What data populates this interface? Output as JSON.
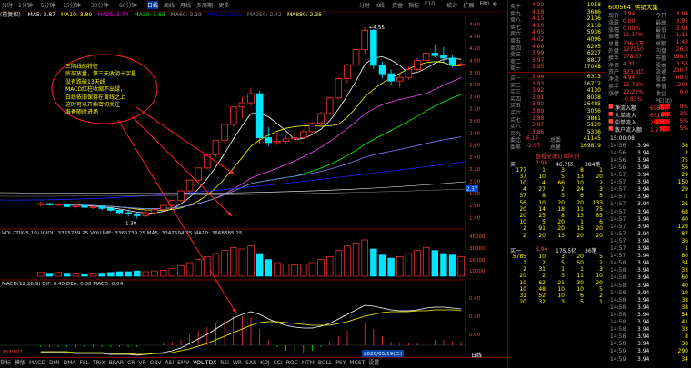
{
  "toolbar": {
    "periods": [
      "分时",
      "1分钟",
      "5分钟",
      "15分钟",
      "30分钟",
      "60分钟",
      "日线",
      "周线",
      "月线",
      "多周期",
      "更多"
    ],
    "indicators": [
      "分时",
      "K线",
      "资金",
      "指标",
      "F10",
      "统计",
      "扩展",
      "F10"
    ],
    "active": "日线"
  },
  "main_title": {
    "name": "(前复权)",
    "ma": [
      "MA5: 3.87",
      "MA10: 3.89",
      "MA20: 3.74",
      "MA30: 3.63",
      "MA60: 3.19",
      "MA120: 2.91",
      "MA250: 2.42",
      "MA880: 2.35"
    ]
  },
  "price_labels": {
    "high": "4.55",
    "low": "1.38",
    "right_ticks": [
      "4.60",
      "4.40",
      "4.20",
      "4.00",
      "3.80",
      "3.60",
      "3.40",
      "3.20",
      "3.00",
      "2.80",
      "2.60",
      "2.40",
      "2.20",
      "2.00",
      "1.80",
      "1.60",
      "1.40"
    ],
    "tag": "2.37"
  },
  "annotation": {
    "lines": [
      "三阴线的特征",
      "底部放量，第三天收阴十字星",
      "没有跌破13天线",
      "MACD红柱收缩不出绿，",
      "白线依旧保持在黄线之上",
      "这时可以开始密切关注",
      "准备随时进场"
    ]
  },
  "volume_title": "VOL-TDX(5,10)  VVOL: 3365739.25  VOLUME: 3365739.25  MA5: 3347594.25  MA10: 3668385.25",
  "volume_ticks": [
    "45000",
    "30000",
    "15000",
    "10000"
  ],
  "macd_title": "MACD(12,26,9)  DIF: 0.40  DEA: 0.38  MACD: 0.04",
  "macd_ticks": [
    "0.40",
    "0.20",
    "0.00"
  ],
  "date_labels": [
    "2020/01",
    "2020/05/19(二)"
  ],
  "bottom_tabs": [
    "指标",
    "模版",
    "MACD",
    "DMI",
    "DMA",
    "FSL",
    "TRIX",
    "BRAR",
    "CR",
    "VR",
    "OBV",
    "ASI",
    "EMV",
    "VOL-TDX",
    "RSI",
    "WR",
    "SAR",
    "KDJ",
    "CCI",
    "ROC",
    "MTM",
    "BOLL",
    "PSY",
    "MCST",
    "设置"
  ],
  "right_tab": "日线",
  "order_book": {
    "asks": [
      {
        "label": "卖十",
        "price": "4.20",
        "vol": "1958"
      },
      {
        "label": "卖九",
        "price": "4.18",
        "vol": "3686"
      },
      {
        "label": "卖八",
        "price": "4.15",
        "vol": "2136"
      },
      {
        "label": "卖七",
        "price": "4.10",
        "vol": "2118"
      },
      {
        "label": "卖六",
        "price": "4.05",
        "vol": "5936"
      },
      {
        "label": "卖五",
        "price": "4.02",
        "vol": "4096"
      },
      {
        "label": "卖四",
        "price": "4.00",
        "vol": "8295"
      },
      {
        "label": "卖三",
        "price": "3.99",
        "vol": "6227"
      },
      {
        "label": "卖二",
        "price": "3.97",
        "vol": "8817"
      },
      {
        "label": "卖一",
        "price": "3.95",
        "vol": "17048"
      }
    ],
    "bids": [
      {
        "label": "买一",
        "price": "3.94",
        "vol": "6313"
      },
      {
        "label": "买二",
        "price": "3.93",
        "vol": "16712"
      },
      {
        "label": "买三",
        "price": "3.92",
        "vol": "4130"
      },
      {
        "label": "买四",
        "price": "3.91",
        "vol": "8038"
      },
      {
        "label": "买五",
        "price": "3.90",
        "vol": "26485"
      },
      {
        "label": "买六",
        "price": "3.89",
        "vol": "3056"
      },
      {
        "label": "买七",
        "price": "3.88",
        "vol": "3861"
      },
      {
        "label": "买八",
        "price": "3.87",
        "vol": "5120"
      },
      {
        "label": "买九",
        "price": "3.86",
        "vol": "5336"
      }
    ],
    "summary": [
      {
        "l": "委比",
        "v": "6.17",
        "l2": "总委",
        "v2": "41145"
      },
      {
        "l": "委差",
        "v": "-2.07",
        "l2": "总量",
        "v2": "169819"
      }
    ]
  },
  "book2": {
    "title": "查看全速订单队列",
    "head": [
      "买一",
      "3.96",
      "46.7亿",
      "384笔"
    ],
    "rows": [
      [
        "177",
        "1",
        "3",
        "8",
        "1"
      ],
      [
        "37",
        "10",
        "5",
        "13",
        "20"
      ],
      [
        "10",
        "4",
        "66",
        "10",
        "2"
      ],
      [
        "4",
        "27",
        "2",
        "24",
        "3"
      ],
      [
        "37",
        "8",
        "3",
        "6",
        "5"
      ],
      [
        "56",
        "10",
        "20",
        "20",
        "133"
      ],
      [
        "20",
        "14",
        "18",
        "11",
        "75"
      ],
      [
        "20",
        "25",
        "8",
        "13",
        "65"
      ],
      [
        "10",
        "5",
        "20",
        "1",
        "6"
      ],
      [
        "2",
        "91",
        "20",
        "15",
        "20"
      ],
      [
        "2",
        "20",
        "13",
        "20",
        "20"
      ]
    ],
    "head2": [
      "买一",
      "3.94",
      "175.5亿",
      "36笔"
    ],
    "rows2": [
      [
        "5785",
        "10",
        "3",
        "20",
        "5"
      ],
      [
        "1",
        "2",
        "5",
        "50",
        "2"
      ],
      [
        "2",
        "31",
        "1",
        "1",
        "3"
      ],
      [
        "20",
        "2",
        "3",
        "11",
        "10"
      ],
      [
        "10",
        "62",
        "21",
        "30",
        "20"
      ],
      [
        "10",
        "48",
        "10",
        "10",
        "5"
      ],
      [
        "31",
        "52",
        "10",
        "6",
        "2"
      ],
      [
        "20",
        "32",
        "3",
        "5",
        "1"
      ]
    ]
  },
  "stock_info": {
    "code": "600564",
    "name": "供销大集",
    "fields": [
      {
        "l": "现价",
        "v": "3.94",
        "l2": "今开",
        "v2": "3.94"
      },
      {
        "l": "涨跌",
        "v": "0.00",
        "l2": "最高",
        "v2": "3.95"
      },
      {
        "l": "涨幅",
        "v": "0.00%",
        "l2": "最低",
        "v2": "3.94"
      },
      {
        "l": "振幅",
        "v": "11.17%",
        "l2": "量比",
        "v2": "1.15"
      },
      {
        "l": "总量",
        "v": "336.6万",
        "l2": "总额",
        "v2": "1.43"
      },
      {
        "l": "外盘",
        "v": "127950",
        "l2": "内盘",
        "v2": "26.3"
      },
      {
        "l": "换手",
        "v": "178.87",
        "l2": "市盈",
        "v2": "198.5"
      },
      {
        "l": "净资",
        "v": "4.31",
        "l2": "股本",
        "v2": "3.55"
      },
      {
        "l": "资产",
        "v": "523.8亿",
        "l2": "流通",
        "v2": "236.7"
      },
      {
        "l": "净流",
        "v": "4.94",
        "l2": "股本",
        "v2": "60.0"
      },
      {
        "l": "换手",
        "v": "15.78%",
        "l2": "市值",
        "v2": "1293"
      },
      {
        "l": "涨停",
        "v": "22.22%",
        "l2": "收益",
        "v2": "0.0"
      },
      {
        "l": "",
        "v": "-0.83%",
        "l2": "PE(动)",
        "v2": ""
      }
    ],
    "flow_labels": [
      "净流入额",
      "大单流入",
      "中单流入",
      "散户流入额"
    ],
    "flow_values": [
      "6958万",
      "6516万",
      "2.27亿",
      "1.27亿"
    ],
    "flow_fracs": [
      0.55,
      0.45,
      0.8,
      0.5
    ],
    "flow_pcts": [
      "9%",
      "3%",
      "5%",
      "5%"
    ]
  },
  "ticks": {
    "time": "15:00:08",
    "rows": [
      [
        "14:56",
        "3.94",
        "38"
      ],
      [
        "14:56",
        "3.94",
        "2"
      ],
      [
        "14:56",
        "3.94",
        "75"
      ],
      [
        "14:56",
        "3.94",
        "56"
      ],
      [
        "14:57",
        "3.94",
        "29"
      ],
      [
        "14:57",
        "3.94",
        "150"
      ],
      [
        "14:57",
        "3.94",
        "29"
      ],
      [
        "14:57",
        "3.94",
        "1"
      ],
      [
        "14:57",
        "3.94",
        "26"
      ],
      [
        "14:57",
        "3.94",
        "68"
      ],
      [
        "14:57",
        "3.94",
        "40"
      ],
      [
        "14:57",
        "3.94",
        "129"
      ],
      [
        "14:57",
        "3.94",
        "87"
      ],
      [
        "14:57",
        "3.94",
        "36"
      ],
      [
        "14:57",
        "3.94",
        "1"
      ],
      [
        "14:57",
        "3.94",
        "80"
      ],
      [
        "14:58",
        "3.94",
        "34"
      ],
      [
        "14:58",
        "3.94",
        "33"
      ],
      [
        "14:58",
        "3.94",
        "60"
      ],
      [
        "14:58",
        "3.94",
        "40"
      ],
      [
        "14:58",
        "3.94",
        "19"
      ],
      [
        "14:58",
        "3.94",
        "38"
      ],
      [
        "14:58",
        "3.94",
        "38"
      ],
      [
        "14:58",
        "3.94",
        "54"
      ],
      [
        "14:58",
        "3.94",
        "41"
      ],
      [
        "14:58",
        "3.94",
        "33"
      ],
      [
        "14:58",
        "3.94",
        "8"
      ],
      [
        "14:58",
        "3.94",
        "38"
      ],
      [
        "14:59",
        "3.94",
        "290"
      ],
      [
        "14:59",
        "3.94",
        "34"
      ],
      [
        "14:59",
        "3.94",
        "5"
      ],
      [
        "14:59",
        "3.94",
        "100"
      ],
      [
        "14:59",
        "3.94",
        "2"
      ],
      [
        "14:59",
        "3.94",
        "68"
      ],
      [
        "14:59",
        "3.94",
        "21"
      ],
      [
        "14:59",
        "3.94",
        "12"
      ],
      [
        "14:59",
        "3.94",
        "34"
      ],
      [
        "14:59",
        "3.94",
        "7"
      ],
      [
        "15:00",
        "3.94",
        "10"
      ],
      [
        "15:00",
        "3.94",
        "4"
      ],
      [
        "15:00",
        "3.94",
        "2"
      ],
      [
        "15:00",
        "3.94",
        "12"
      ],
      [
        "15:00",
        "3.94",
        "8"
      ],
      [
        "15:00",
        "3.94",
        "5"
      ],
      [
        "15:00",
        "3.94",
        "6"
      ]
    ]
  },
  "chart_data": {
    "type": "candlestick",
    "ylim": [
      1.3,
      4.7
    ],
    "candles": [
      {
        "o": 1.62,
        "h": 1.66,
        "l": 1.58,
        "c": 1.63
      },
      {
        "o": 1.63,
        "h": 1.65,
        "l": 1.6,
        "c": 1.61
      },
      {
        "o": 1.61,
        "h": 1.64,
        "l": 1.58,
        "c": 1.62
      },
      {
        "o": 1.62,
        "h": 1.63,
        "l": 1.57,
        "c": 1.58
      },
      {
        "o": 1.58,
        "h": 1.62,
        "l": 1.55,
        "c": 1.6
      },
      {
        "o": 1.6,
        "h": 1.62,
        "l": 1.56,
        "c": 1.57
      },
      {
        "o": 1.57,
        "h": 1.6,
        "l": 1.54,
        "c": 1.58
      },
      {
        "o": 1.58,
        "h": 1.6,
        "l": 1.52,
        "c": 1.55
      },
      {
        "o": 1.55,
        "h": 1.58,
        "l": 1.5,
        "c": 1.52
      },
      {
        "o": 1.52,
        "h": 1.54,
        "l": 1.45,
        "c": 1.48
      },
      {
        "o": 1.48,
        "h": 1.52,
        "l": 1.42,
        "c": 1.46
      },
      {
        "o": 1.46,
        "h": 1.48,
        "l": 1.38,
        "c": 1.43
      },
      {
        "o": 1.43,
        "h": 1.5,
        "l": 1.41,
        "c": 1.48
      },
      {
        "o": 1.48,
        "h": 1.55,
        "l": 1.46,
        "c": 1.53
      },
      {
        "o": 1.53,
        "h": 1.62,
        "l": 1.51,
        "c": 1.6
      },
      {
        "o": 1.6,
        "h": 1.7,
        "l": 1.58,
        "c": 1.68
      },
      {
        "o": 1.68,
        "h": 1.85,
        "l": 1.66,
        "c": 1.84
      },
      {
        "o": 1.84,
        "h": 2.02,
        "l": 1.82,
        "c": 2.02
      },
      {
        "o": 2.02,
        "h": 2.22,
        "l": 2.0,
        "c": 2.22
      },
      {
        "o": 2.22,
        "h": 2.44,
        "l": 2.2,
        "c": 2.44
      },
      {
        "o": 2.44,
        "h": 2.68,
        "l": 2.4,
        "c": 2.68
      },
      {
        "o": 2.68,
        "h": 2.95,
        "l": 2.6,
        "c": 2.94
      },
      {
        "o": 2.94,
        "h": 3.24,
        "l": 2.9,
        "c": 3.23
      },
      {
        "o": 3.23,
        "h": 3.4,
        "l": 3.05,
        "c": 3.3
      },
      {
        "o": 3.3,
        "h": 3.55,
        "l": 3.25,
        "c": 3.45
      },
      {
        "o": 3.45,
        "h": 3.5,
        "l": 2.62,
        "c": 2.72
      },
      {
        "o": 2.72,
        "h": 2.9,
        "l": 2.58,
        "c": 2.64
      },
      {
        "o": 2.64,
        "h": 2.8,
        "l": 2.6,
        "c": 2.66
      },
      {
        "o": 2.66,
        "h": 2.76,
        "l": 2.62,
        "c": 2.7
      },
      {
        "o": 2.7,
        "h": 2.78,
        "l": 2.64,
        "c": 2.72
      },
      {
        "o": 2.72,
        "h": 2.85,
        "l": 2.7,
        "c": 2.82
      },
      {
        "o": 2.82,
        "h": 2.98,
        "l": 2.8,
        "c": 2.96
      },
      {
        "o": 2.96,
        "h": 3.15,
        "l": 2.92,
        "c": 3.12
      },
      {
        "o": 3.12,
        "h": 3.4,
        "l": 3.1,
        "c": 3.38
      },
      {
        "o": 3.38,
        "h": 3.72,
        "l": 3.36,
        "c": 3.7
      },
      {
        "o": 3.7,
        "h": 3.95,
        "l": 3.62,
        "c": 3.92
      },
      {
        "o": 3.92,
        "h": 4.2,
        "l": 3.8,
        "c": 4.18
      },
      {
        "o": 4.18,
        "h": 4.55,
        "l": 4.1,
        "c": 4.5
      },
      {
        "o": 4.5,
        "h": 4.52,
        "l": 3.86,
        "c": 3.92
      },
      {
        "o": 3.92,
        "h": 3.98,
        "l": 3.7,
        "c": 3.78
      },
      {
        "o": 3.78,
        "h": 3.85,
        "l": 3.6,
        "c": 3.66
      },
      {
        "o": 3.66,
        "h": 3.8,
        "l": 3.55,
        "c": 3.72
      },
      {
        "o": 3.72,
        "h": 3.9,
        "l": 3.68,
        "c": 3.85
      },
      {
        "o": 3.85,
        "h": 4.05,
        "l": 3.8,
        "c": 4.0
      },
      {
        "o": 4.0,
        "h": 4.18,
        "l": 3.95,
        "c": 4.12
      },
      {
        "o": 4.12,
        "h": 4.25,
        "l": 4.05,
        "c": 4.08
      },
      {
        "o": 4.08,
        "h": 4.22,
        "l": 3.95,
        "c": 4.04
      },
      {
        "o": 4.04,
        "h": 4.1,
        "l": 3.88,
        "c": 3.92
      },
      {
        "o": 3.92,
        "h": 3.98,
        "l": 3.9,
        "c": 3.94
      }
    ],
    "volumes": [
      5,
      4,
      5,
      4,
      4,
      3,
      4,
      4,
      5,
      6,
      6,
      7,
      6,
      7,
      8,
      10,
      14,
      18,
      22,
      26,
      30,
      34,
      38,
      36,
      40,
      30,
      22,
      18,
      16,
      15,
      16,
      18,
      22,
      26,
      34,
      40,
      44,
      48,
      36,
      28,
      24,
      26,
      30,
      34,
      38,
      34,
      30,
      28,
      26
    ],
    "macd_dif": [
      -0.08,
      -0.08,
      -0.08,
      -0.08,
      -0.09,
      -0.09,
      -0.09,
      -0.09,
      -0.1,
      -0.1,
      -0.1,
      -0.11,
      -0.1,
      -0.09,
      -0.08,
      -0.06,
      -0.03,
      0.02,
      0.07,
      0.12,
      0.18,
      0.24,
      0.3,
      0.34,
      0.37,
      0.34,
      0.29,
      0.25,
      0.22,
      0.2,
      0.19,
      0.19,
      0.21,
      0.24,
      0.29,
      0.34,
      0.39,
      0.44,
      0.43,
      0.41,
      0.39,
      0.38,
      0.38,
      0.39,
      0.41,
      0.42,
      0.42,
      0.41,
      0.4
    ],
    "macd_dea": [
      -0.07,
      -0.07,
      -0.07,
      -0.07,
      -0.08,
      -0.08,
      -0.08,
      -0.08,
      -0.09,
      -0.09,
      -0.09,
      -0.1,
      -0.1,
      -0.09,
      -0.09,
      -0.08,
      -0.06,
      -0.04,
      -0.01,
      0.02,
      0.06,
      0.1,
      0.14,
      0.18,
      0.22,
      0.25,
      0.26,
      0.26,
      0.25,
      0.24,
      0.23,
      0.22,
      0.22,
      0.22,
      0.24,
      0.26,
      0.29,
      0.32,
      0.34,
      0.36,
      0.37,
      0.37,
      0.37,
      0.38,
      0.38,
      0.39,
      0.39,
      0.39,
      0.38
    ]
  }
}
